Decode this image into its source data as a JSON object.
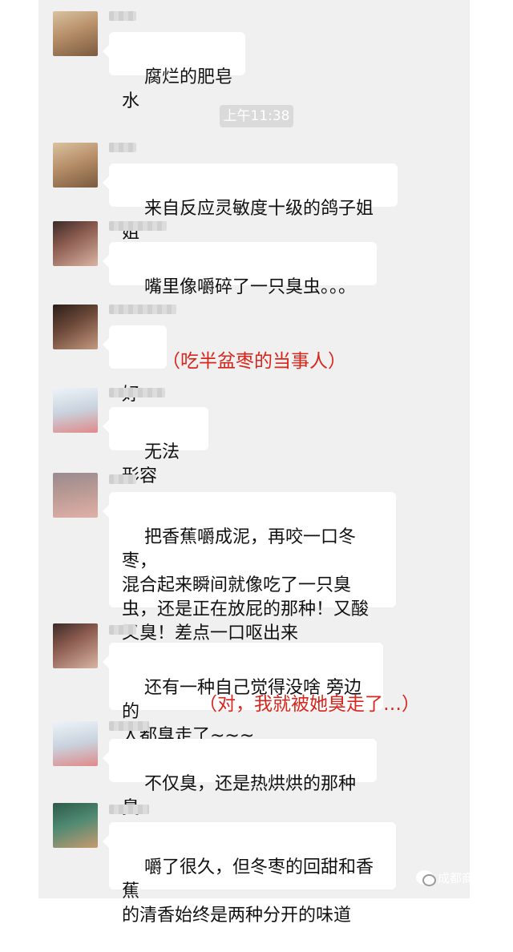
{
  "timestamp": "上午11:38",
  "messages": [
    {
      "text": "腐烂的肥皂水",
      "avatar_color": "#b8906a"
    },
    {
      "text": "来自反应灵敏度十级的鸽子姐姐",
      "avatar_color": "#b8906a"
    },
    {
      "text": "嘴里像嚼碎了一只臭虫。。。",
      "avatar_color": "#8a5a4e"
    },
    {
      "text": "好吃",
      "avatar_color": "#6e4a3a"
    },
    {
      "text": "无法形容",
      "avatar_color": "#c9d3de"
    },
    {
      "text": "把香蕉嚼成泥，再咬一口冬枣，\n混合起来瞬间就像吃了一只臭\n虫，还是正在放屁的那种！又酸\n又臭！差点一口呕出来",
      "avatar_color": "#b99a94"
    },
    {
      "text": "还有一种自己觉得没啥 旁边的\n人都臭走了~~~",
      "avatar_color": "#8a5a4e"
    },
    {
      "text": "不仅臭，还是热烘烘的那种臭",
      "avatar_color": "#c9d3de"
    },
    {
      "text": "嚼了很久，但冬枣的回甜和香蕉\n的清香始终是两种分开的味道",
      "avatar_color": "#4f8a72"
    }
  ],
  "annotations": {
    "eater": "（吃半盆枣的当事人）",
    "smelled": "（对，我就被她臭走了…）"
  },
  "watermark": "成都商报",
  "colors": {
    "chat_background": "#f0f0f0",
    "bubble": "#ffffff",
    "annotation_red": "#d9261c",
    "timestamp_bg": "#dadada"
  }
}
